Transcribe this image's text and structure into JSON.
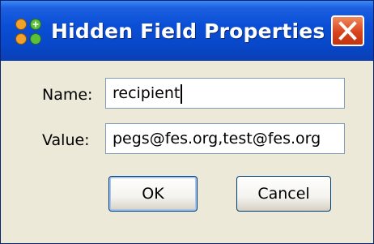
{
  "window": {
    "title": "Hidden Field Properties",
    "app_icon": "app-icon",
    "close_icon": "close-icon"
  },
  "form": {
    "name_label": "Name:",
    "name_value": "recipient",
    "value_label": "Value:",
    "value_value": "pegs@fes.org,test@fes.org"
  },
  "buttons": {
    "ok_label": "OK",
    "cancel_label": "Cancel"
  },
  "colors": {
    "title_bar": "#0a4fd6",
    "close_button": "#d8431c",
    "dialog_background": "#ece9d8"
  }
}
